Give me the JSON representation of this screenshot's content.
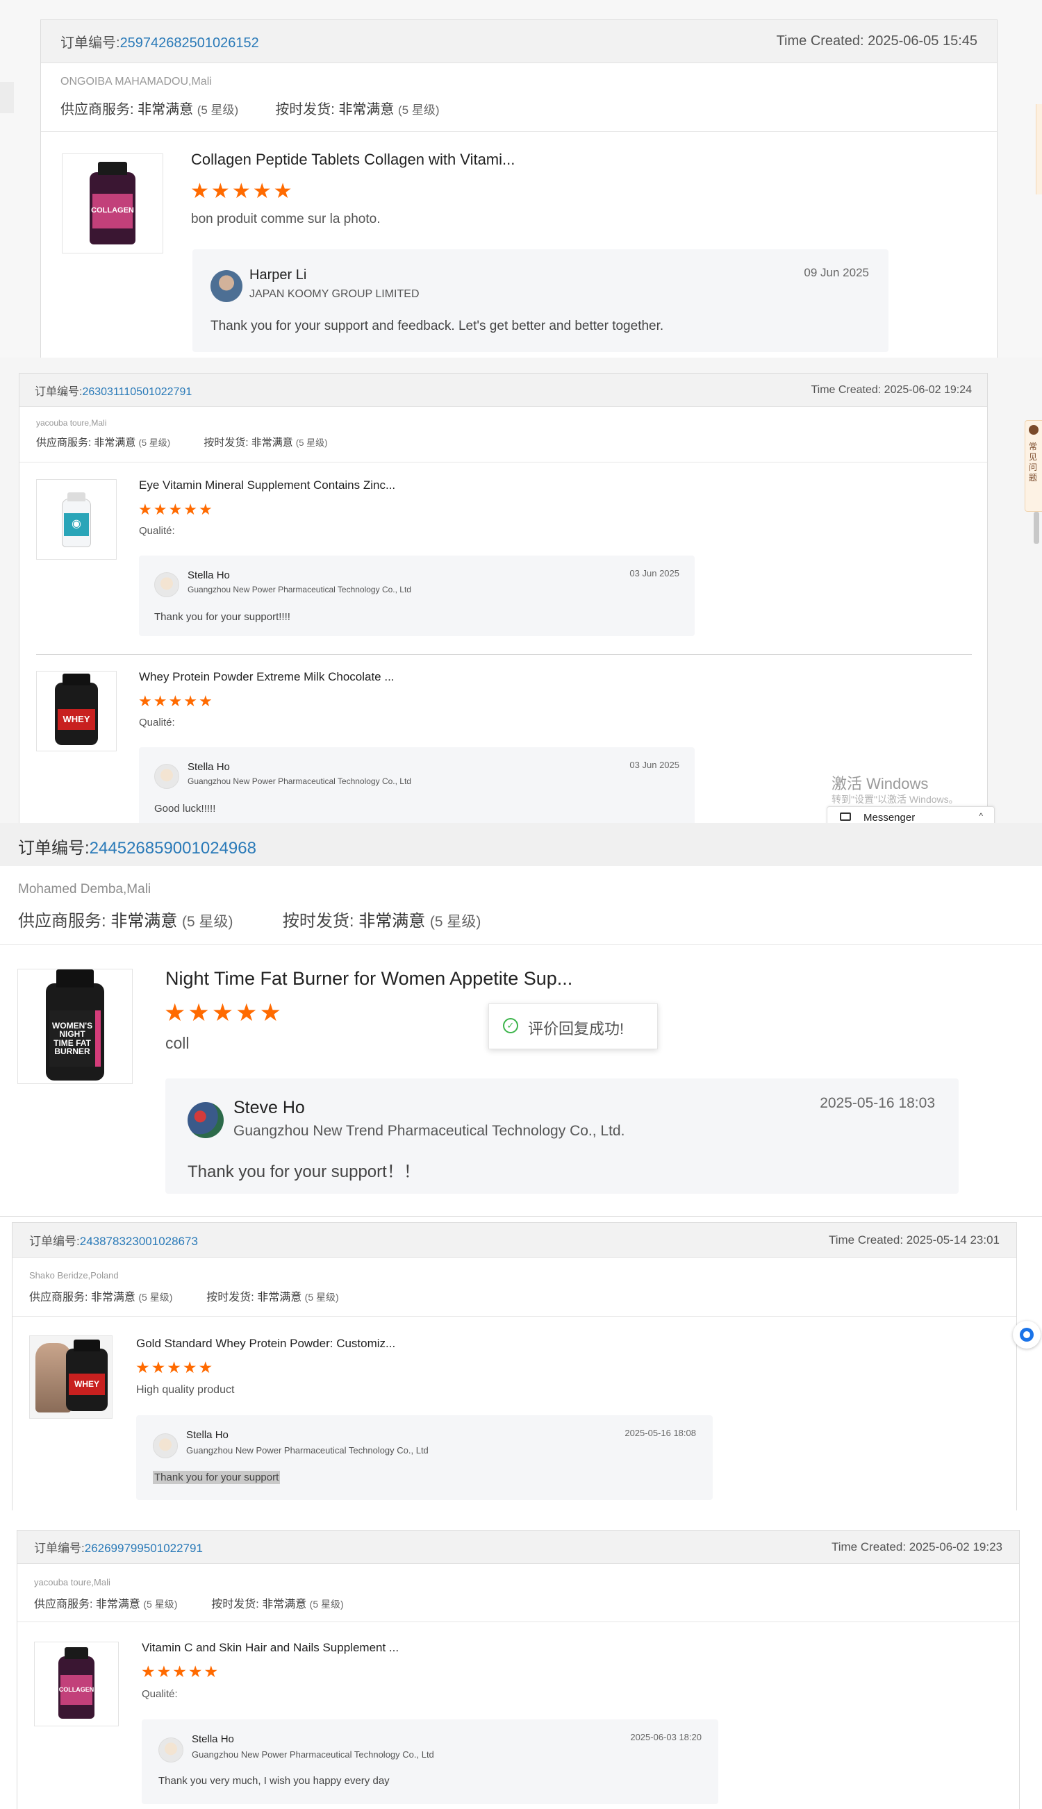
{
  "panel1": {
    "order_label": "订单编号:",
    "order_no": "259742682501026152",
    "time_created": "Time Created: 2025-06-05 15:45",
    "buyer": "ONGOIBA MAHAMADOU,Mali",
    "service_label": "供应商服务:",
    "service_value": "非常满意",
    "service_level": "(5 星级)",
    "shipping_label": "按时发货:",
    "shipping_value": "非常满意",
    "shipping_level": "(5 星级)",
    "product_title": "Collagen Peptide Tablets Collagen with Vitami...",
    "product_img_text": "COLLAGEN",
    "review": "bon produit comme sur la photo.",
    "reply_name": "Harper Li",
    "reply_company": "JAPAN KOOMY GROUP LIMITED",
    "reply_date": "09 Jun 2025",
    "reply_msg": "Thank you for your support and feedback. Let's get better and better together."
  },
  "panel2": {
    "order_label": "订单编号:",
    "order_no": "263031110501022791",
    "time_created": "Time Created: 2025-06-02 19:24",
    "buyer": "yacouba toure,Mali",
    "service_label": "供应商服务:",
    "service_value": "非常满意",
    "service_level": "(5 星级)",
    "shipping_label": "按时发货:",
    "shipping_value": "非常满意",
    "shipping_level": "(5 星级)",
    "items": [
      {
        "product_title": "Eye Vitamin Mineral Supplement Contains Zinc...",
        "review": "Qualité:",
        "reply_name": "Stella Ho",
        "reply_company": "Guangzhou New Power Pharmaceutical Technology Co., Ltd",
        "reply_date": "03 Jun 2025",
        "reply_msg": "Thank you for your support!!!!"
      },
      {
        "product_title": "Whey Protein Powder Extreme Milk Chocolate ...",
        "product_img_text": "WHEY",
        "review": "Qualité:",
        "reply_name": "Stella Ho",
        "reply_company": "Guangzhou New Power Pharmaceutical Technology Co., Ltd",
        "reply_date": "03 Jun 2025",
        "reply_msg": "Good luck!!!!!"
      }
    ],
    "faq_label": "常见问题",
    "watermark_title": "激活 Windows",
    "watermark_sub": "转到\"设置\"以激活 Windows。",
    "messenger_label": "Messenger"
  },
  "panel3": {
    "order_label": "订单编号:",
    "order_no": "244526859001024968",
    "buyer": "Mohamed Demba,Mali",
    "service_label": "供应商服务:",
    "service_value": "非常满意",
    "service_level": "(5 星级)",
    "shipping_label": "按时发货:",
    "shipping_value": "非常满意",
    "shipping_level": "(5 星级)",
    "product_title": "Night Time Fat Burner for Women Appetite Sup...",
    "product_img_text": "WOMEN'S NIGHT TIME FAT BURNER",
    "review": "coll",
    "toast": "评价回复成功!",
    "reply_name": "Steve Ho",
    "reply_company": "Guangzhou New Trend Pharmaceutical Technology Co., Ltd.",
    "reply_date": "2025-05-16 18:03",
    "reply_msg": "Thank you for your support！！"
  },
  "panel4": {
    "order_label": "订单编号:",
    "order_no": "243878323001028673",
    "time_created": "Time Created: 2025-05-14 23:01",
    "buyer": "Shako Beridze,Poland",
    "service_label": "供应商服务:",
    "service_value": "非常满意",
    "service_level": "(5 星级)",
    "shipping_label": "按时发货:",
    "shipping_value": "非常满意",
    "shipping_level": "(5 星级)",
    "product_title": "Gold Standard Whey Protein Powder: Customiz...",
    "product_img_text": "WHEY",
    "review": "High quality product",
    "reply_name": "Stella Ho",
    "reply_company": "Guangzhou New Power Pharmaceutical Technology Co., Ltd",
    "reply_date": "2025-05-16 18:08",
    "reply_msg": "Thank you for your support"
  },
  "panel5": {
    "order_label": "订单编号:",
    "order_no": "262699799501022791",
    "time_created": "Time Created: 2025-06-02 19:23",
    "buyer": "yacouba toure,Mali",
    "service_label": "供应商服务:",
    "service_value": "非常满意",
    "service_level": "(5 星级)",
    "shipping_label": "按时发货:",
    "shipping_value": "非常满意",
    "shipping_level": "(5 星级)",
    "product_title": "Vitamin C and Skin Hair and Nails Supplement ...",
    "product_img_text": "COLLAGEN",
    "review": "Qualité:",
    "reply_name": "Stella Ho",
    "reply_company": "Guangzhou New Power Pharmaceutical Technology Co., Ltd",
    "reply_date": "2025-06-03 18:20",
    "reply_msg": "Thank you very much, I wish you happy every day"
  },
  "star_count": 5,
  "colors": {
    "link": "#2a7ab8",
    "star": "#ff6a00",
    "header_bg": "#f2f2f2",
    "reply_bg": "#f5f6f8"
  }
}
